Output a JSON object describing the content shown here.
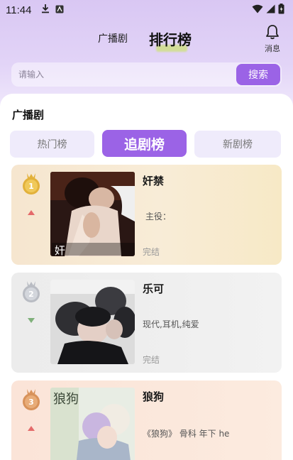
{
  "status_bar": {
    "time": "11:44"
  },
  "header": {
    "tab_radio": "广播剧",
    "tab_ranking": "排行榜",
    "notify_label": "消息"
  },
  "search": {
    "placeholder": "请输入",
    "button": "搜索"
  },
  "section": {
    "title": "广播剧"
  },
  "rank_tabs": [
    {
      "label": "热门榜",
      "active": false
    },
    {
      "label": "追剧榜",
      "active": true
    },
    {
      "label": "新剧榜",
      "active": false
    }
  ],
  "cards": [
    {
      "rank": "1",
      "trend": "up",
      "title": "奸禁",
      "desc": "主役：",
      "status": "完结",
      "cover_text": "奸",
      "medal_color": "#e2b13a"
    },
    {
      "rank": "2",
      "trend": "down",
      "title": "乐可",
      "desc": "现代,耳机,纯爱",
      "status": "完结",
      "medal_color": "#b9bcc3"
    },
    {
      "rank": "3",
      "trend": "up",
      "title": "狼狗",
      "desc": "《狼狗》 骨科 年下 he",
      "cover_text": "狼狗",
      "medal_color": "#d8925a"
    }
  ],
  "colors": {
    "accent": "#9b63e6",
    "trend_up": "#e46a6a",
    "trend_down": "#7fb07a"
  }
}
